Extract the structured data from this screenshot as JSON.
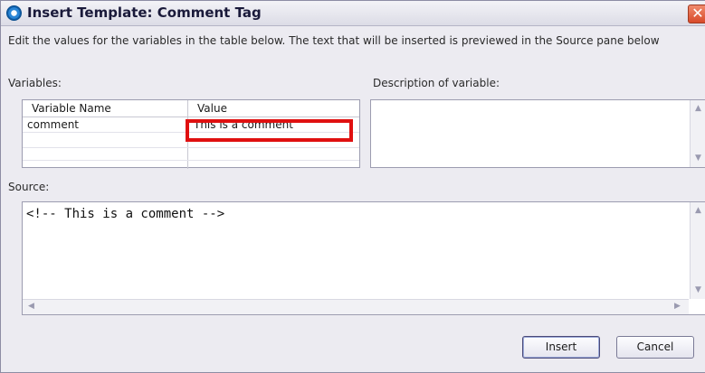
{
  "window": {
    "title": "Insert Template: Comment Tag"
  },
  "instructions": "Edit the values for the variables in the table below.  The text that will be inserted is previewed in the Source pane below",
  "variables": {
    "label": "Variables:",
    "columns": [
      "Variable Name",
      "Value"
    ],
    "rows": [
      {
        "name": "comment",
        "value": "This is a comment"
      }
    ]
  },
  "description": {
    "label": "Description of variable:",
    "text": ""
  },
  "source": {
    "label": "Source:",
    "text": "<!-- This is a comment -->"
  },
  "buttons": {
    "insert": "Insert",
    "cancel": "Cancel"
  },
  "colors": {
    "highlight": "#e01010",
    "close_button": "#d84a2a"
  }
}
